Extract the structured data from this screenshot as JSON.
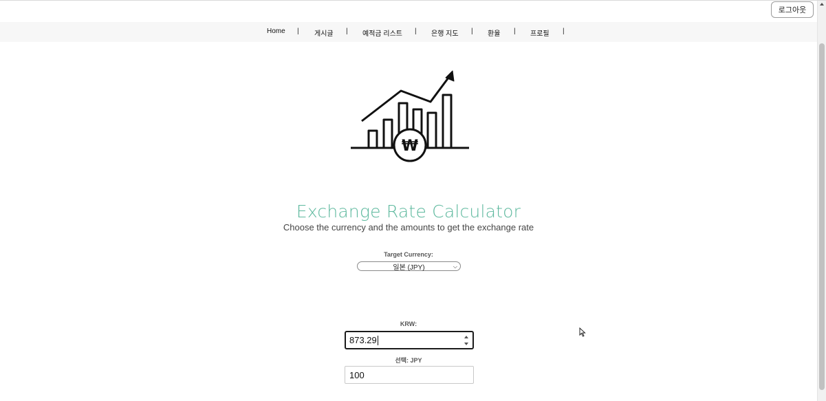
{
  "header": {
    "logout_label": "로그아웃"
  },
  "nav": {
    "items": [
      {
        "label": "Home"
      },
      {
        "label": "게시글"
      },
      {
        "label": "예적금 리스트"
      },
      {
        "label": "은행 지도"
      },
      {
        "label": "환율"
      },
      {
        "label": "프로필"
      }
    ],
    "separator": "|"
  },
  "hero": {
    "icon": "exchange-rate-chart-won-icon",
    "currency_symbol": "₩"
  },
  "calculator": {
    "title": "Exchange Rate Calculator",
    "subtitle": "Choose the currency and the amounts to get the exchange rate",
    "target_label": "Target Currency:",
    "target_selected": "일본 (JPY)",
    "krw_label": "KRW:",
    "krw_value": "873.29",
    "selected_label": "선택: JPY",
    "selected_value": "100"
  },
  "colors": {
    "accent": "#5cb89d"
  }
}
